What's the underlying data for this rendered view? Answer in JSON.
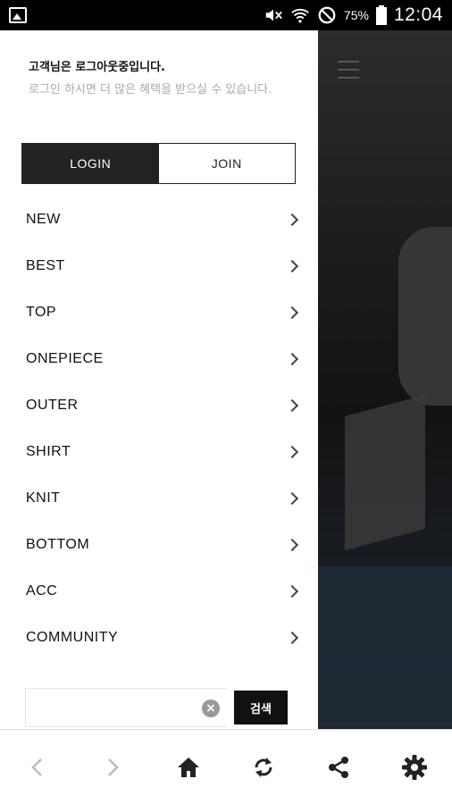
{
  "statusbar": {
    "battery_text": "75%",
    "time": "12:04"
  },
  "drawer": {
    "greeting_line1": "고객님은 로그아웃중입니다.",
    "greeting_line2": "로그인 하시면 더 많은 혜택을 받으실 수 있습니다.",
    "login_label": "LOGIN",
    "join_label": "JOIN",
    "menu": [
      {
        "label": "NEW"
      },
      {
        "label": "BEST"
      },
      {
        "label": "TOP"
      },
      {
        "label": "ONEPIECE"
      },
      {
        "label": "OUTER"
      },
      {
        "label": "SHIRT"
      },
      {
        "label": "KNIT"
      },
      {
        "label": "BOTTOM"
      },
      {
        "label": "ACC"
      },
      {
        "label": "COMMUNITY"
      }
    ],
    "search": {
      "value": "",
      "button_label": "검색"
    }
  },
  "bottom_nav": [
    {
      "icon": "back-icon"
    },
    {
      "icon": "forward-icon"
    },
    {
      "icon": "home-icon"
    },
    {
      "icon": "refresh-icon"
    },
    {
      "icon": "share-icon"
    },
    {
      "icon": "settings-icon"
    }
  ],
  "colors": {
    "accent": "#222222",
    "status_bg": "#000000"
  }
}
